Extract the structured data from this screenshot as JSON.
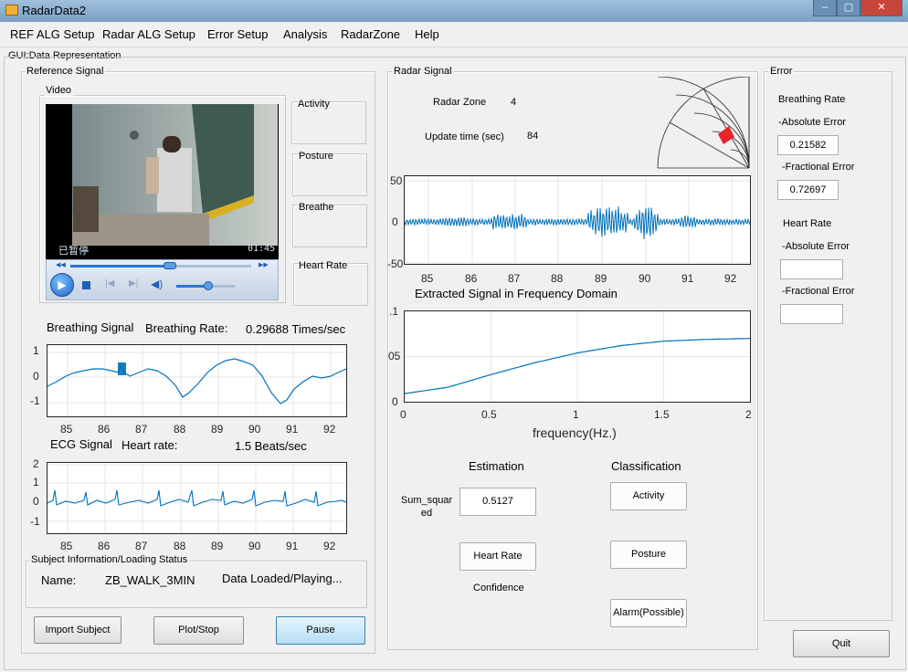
{
  "window": {
    "title": "RadarData2",
    "min": "–",
    "max": "▢",
    "close": "✕"
  },
  "menu": [
    "REF ALG Setup",
    "Radar ALG Setup",
    "Error Setup",
    "Analysis",
    "RadarZone",
    "Help"
  ],
  "gui_label": "GUI:Data Representation",
  "reference": {
    "title": "Reference Signal",
    "video": {
      "title": "Video",
      "status": "已暂停",
      "time": "01:45",
      "progress": 0.55,
      "volume": 0.55
    },
    "side_boxes": [
      "Activity",
      "Posture",
      "Breathe",
      "Heart Rate"
    ],
    "breathing": {
      "label": "Breathing Signal",
      "rate_label": "Breathing Rate:",
      "rate_value": "0.29688 Times/sec",
      "yticks": [
        "1",
        "0",
        "-1"
      ],
      "xticks": [
        "85",
        "86",
        "87",
        "88",
        "89",
        "90",
        "91",
        "92"
      ]
    },
    "ecg": {
      "label": "ECG Signal",
      "rate_label": "Heart rate:",
      "rate_value": "1.5 Beats/sec",
      "yticks": [
        "2",
        "1",
        "0",
        "-1"
      ],
      "xticks": [
        "85",
        "86",
        "87",
        "88",
        "89",
        "90",
        "91",
        "92"
      ]
    },
    "subject": {
      "title": "Subject Information/Loading Status",
      "name_label": "Name:",
      "name_value": "ZB_WALK_3MIN",
      "status": "Data Loaded/Playing..."
    },
    "buttons": {
      "import": "Import Subject",
      "plot": "Plot/Stop",
      "pause": "Pause"
    }
  },
  "radar": {
    "title": "Radar Signal",
    "zone_label": "Radar Zone",
    "zone_value": "4",
    "update_label": "Update time (sec)",
    "update_value": "84",
    "signal_yticks": [
      "50",
      "0",
      "-50"
    ],
    "signal_xticks": [
      "85",
      "86",
      "87",
      "88",
      "89",
      "90",
      "91",
      "92"
    ],
    "freq_title": "Extracted Signal in Frequency Domain",
    "freq_yticks": [
      ".1",
      "05",
      "0"
    ],
    "freq_xticks": [
      "0",
      "0.5",
      "1",
      "1.5",
      "2"
    ],
    "freq_xlabel": "frequency(Hz.)",
    "estimation": {
      "title": "Estimation",
      "sum_label": "Sum_squar\ned",
      "sum_value": "0.5127",
      "heart_button": "Heart Rate",
      "confidence": "Confidence"
    },
    "classification": {
      "title": "Classification",
      "activity": "Activity",
      "posture": "Posture",
      "alarm": "Alarm(Possible)"
    }
  },
  "error": {
    "title": "Error",
    "breathing_title": "Breathing Rate",
    "abs_label": "-Absolute Error",
    "abs_value": "0.21582",
    "frac_label": "-Fractional Error",
    "frac_value": "0.72697",
    "heart_title": "Heart Rate",
    "heart_abs_label": "-Absolute Error",
    "heart_abs_value": "",
    "heart_frac_label": "-Fractional Error",
    "heart_frac_value": "",
    "quit": "Quit"
  },
  "chart_data": [
    {
      "type": "line",
      "title": "",
      "xlabel": "",
      "ylabel": "",
      "xlim": [
        84.4,
        92.4
      ],
      "ylim": [
        -1.5,
        1.2
      ],
      "series": [
        {
          "values_desc": "breathing waveform"
        }
      ]
    },
    {
      "type": "line",
      "title": "",
      "xlabel": "",
      "ylabel": "",
      "xlim": [
        84.4,
        92.4
      ],
      "ylim": [
        -1.7,
        2.1
      ],
      "series": [
        {
          "values_desc": "ECG waveform"
        }
      ]
    },
    {
      "type": "line",
      "title": "",
      "xlabel": "",
      "ylabel": "",
      "xlim": [
        84.4,
        92.4
      ],
      "ylim": [
        -52,
        52
      ],
      "series": [
        {
          "values_desc": "radar signal"
        }
      ]
    },
    {
      "type": "line",
      "title": "Extracted Signal in Frequency Domain",
      "xlabel": "frequency(Hz.)",
      "ylabel": "",
      "xlim": [
        0,
        2
      ],
      "ylim": [
        0,
        0.1
      ],
      "series": [
        {
          "x": [
            0,
            0.25,
            0.5,
            0.75,
            1,
            1.25,
            1.5,
            1.75,
            2
          ],
          "y": [
            0.009,
            0.016,
            0.03,
            0.043,
            0.054,
            0.062,
            0.067,
            0.069,
            0.07
          ]
        }
      ]
    }
  ]
}
